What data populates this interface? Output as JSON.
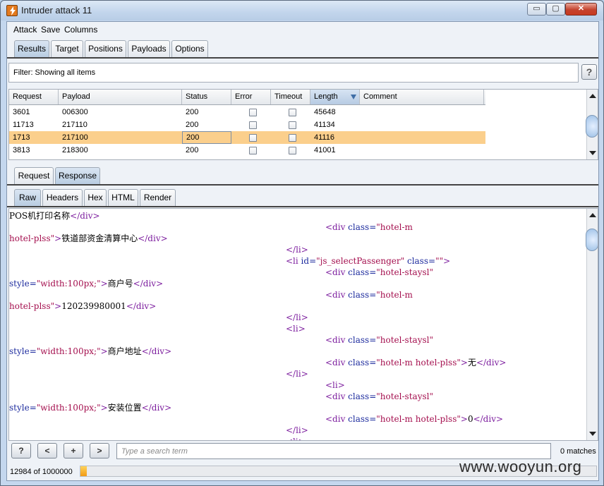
{
  "window": {
    "title": "Intruder attack 11",
    "min_glyph": "▭",
    "max_glyph": "▢",
    "close_glyph": "✕"
  },
  "menu": [
    "Attack",
    "Save",
    "Columns"
  ],
  "main_tabs": [
    "Results",
    "Target",
    "Positions",
    "Payloads",
    "Options"
  ],
  "filter": {
    "text": "Filter:  Showing all items",
    "help": "?"
  },
  "table": {
    "columns": [
      "Request",
      "Payload",
      "Status",
      "Error",
      "Timeout",
      "Length",
      "Comment"
    ],
    "sorted_column": "Length",
    "rows": [
      {
        "request": "3601",
        "payload": "006300",
        "status": "200",
        "error": false,
        "timeout": false,
        "length": "45648",
        "comment": ""
      },
      {
        "request": "11713",
        "payload": "217110",
        "status": "200",
        "error": false,
        "timeout": false,
        "length": "41134",
        "comment": ""
      },
      {
        "request": "1713",
        "payload": "217100",
        "status": "200",
        "error": false,
        "timeout": false,
        "length": "41116",
        "comment": ""
      },
      {
        "request": "3813",
        "payload": "218300",
        "status": "200",
        "error": false,
        "timeout": false,
        "length": "41001",
        "comment": ""
      }
    ],
    "selected_row": 2,
    "highlight_color": "#fbcf8c"
  },
  "reqresp_tabs": [
    "Request",
    "Response"
  ],
  "view_tabs": [
    "Raw",
    "Headers",
    "Hex",
    "HTML",
    "Render"
  ],
  "response_lines": [
    {
      "indent": 0,
      "parts": [
        [
          "t",
          "POS机打印名称"
        ],
        [
          "g",
          "</div>"
        ]
      ]
    },
    {
      "indent": 448,
      "parts": [
        [
          "g",
          "<div "
        ],
        [
          "a",
          "class="
        ],
        [
          "s",
          "\"hotel-m"
        ]
      ]
    },
    {
      "indent": 0,
      "parts": [
        [
          "s",
          "hotel-plss\""
        ],
        [
          "g",
          ">"
        ],
        [
          "t",
          "铁道部资金清算中心"
        ],
        [
          "g",
          "</div>"
        ]
      ]
    },
    {
      "indent": 392,
      "parts": [
        [
          "g",
          "</li>"
        ]
      ]
    },
    {
      "indent": 392,
      "parts": [
        [
          "g",
          "<li "
        ],
        [
          "a",
          "id="
        ],
        [
          "s",
          "\"js_selectPassenger\" "
        ],
        [
          "a",
          "class="
        ],
        [
          "s",
          "\"\""
        ],
        [
          "g",
          ">"
        ]
      ]
    },
    {
      "indent": 448,
      "parts": [
        [
          "g",
          "<div "
        ],
        [
          "a",
          "class="
        ],
        [
          "s",
          "\"hotel-staysl\""
        ]
      ]
    },
    {
      "indent": 0,
      "parts": [
        [
          "a",
          "style="
        ],
        [
          "s",
          "\"width:100px;\""
        ],
        [
          "g",
          ">"
        ],
        [
          "t",
          "商户号"
        ],
        [
          "g",
          "</div>"
        ]
      ]
    },
    {
      "indent": 448,
      "parts": [
        [
          "g",
          "<div "
        ],
        [
          "a",
          "class="
        ],
        [
          "s",
          "\"hotel-m"
        ]
      ]
    },
    {
      "indent": 0,
      "parts": [
        [
          "s",
          "hotel-plss\""
        ],
        [
          "g",
          ">"
        ],
        [
          "t",
          "120239980001"
        ],
        [
          "g",
          "</div>"
        ]
      ]
    },
    {
      "indent": 392,
      "parts": [
        [
          "g",
          "</li>"
        ]
      ]
    },
    {
      "indent": 392,
      "parts": [
        [
          "g",
          "<li>"
        ]
      ]
    },
    {
      "indent": 448,
      "parts": [
        [
          "g",
          "<div "
        ],
        [
          "a",
          "class="
        ],
        [
          "s",
          "\"hotel-staysl\""
        ]
      ]
    },
    {
      "indent": 0,
      "parts": [
        [
          "a",
          "style="
        ],
        [
          "s",
          "\"width:100px;\""
        ],
        [
          "g",
          ">"
        ],
        [
          "t",
          "商户地址"
        ],
        [
          "g",
          "</div>"
        ]
      ]
    },
    {
      "indent": 448,
      "parts": [
        [
          "g",
          "<div "
        ],
        [
          "a",
          "class="
        ],
        [
          "s",
          "\"hotel-m hotel-plss\""
        ],
        [
          "g",
          ">"
        ],
        [
          "t",
          "无"
        ],
        [
          "g",
          "</div>"
        ]
      ]
    },
    {
      "indent": 392,
      "parts": [
        [
          "g",
          "</li>"
        ]
      ]
    },
    {
      "indent": 448,
      "parts": [
        [
          "g",
          "<li>"
        ]
      ]
    },
    {
      "indent": 448,
      "parts": [
        [
          "g",
          "<div "
        ],
        [
          "a",
          "class="
        ],
        [
          "s",
          "\"hotel-staysl\""
        ]
      ]
    },
    {
      "indent": 0,
      "parts": [
        [
          "a",
          "style="
        ],
        [
          "s",
          "\"width:100px;\""
        ],
        [
          "g",
          ">"
        ],
        [
          "t",
          "安装位置"
        ],
        [
          "g",
          "</div>"
        ]
      ]
    },
    {
      "indent": 448,
      "parts": [
        [
          "g",
          "<div "
        ],
        [
          "a",
          "class="
        ],
        [
          "s",
          "\"hotel-m hotel-plss\""
        ],
        [
          "g",
          ">"
        ],
        [
          "t",
          "0"
        ],
        [
          "g",
          "</div>"
        ]
      ]
    },
    {
      "indent": 392,
      "parts": [
        [
          "g",
          "</li>"
        ]
      ]
    },
    {
      "indent": 392,
      "parts": [
        [
          "g",
          "<li>"
        ]
      ]
    }
  ],
  "search": {
    "help": "?",
    "prev": "<",
    "add": "+",
    "next": ">",
    "placeholder": "Type a search term",
    "matches": "0 matches"
  },
  "status": {
    "progress_text": "12984 of 1000000",
    "progress_fraction": 0.012984
  },
  "watermark": "www.wooyun.org"
}
